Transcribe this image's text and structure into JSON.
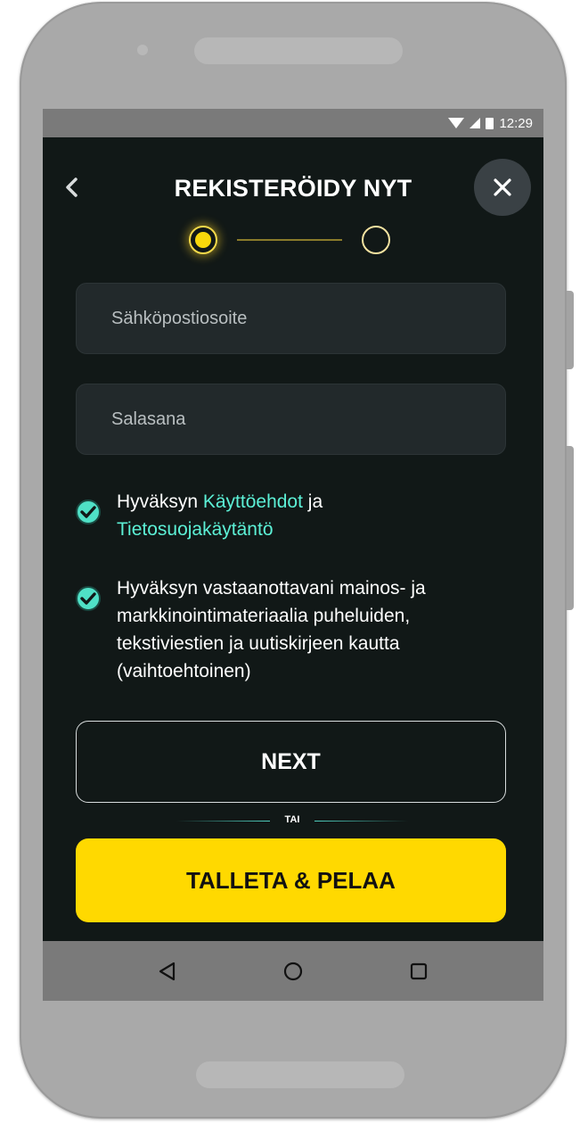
{
  "statusbar": {
    "time": "12:29"
  },
  "header": {
    "title": "REKISTERÖIDY NYT"
  },
  "stepper": {
    "current_step": 1,
    "total_steps": 2
  },
  "form": {
    "email_placeholder": "Sähköpostiosoite",
    "password_placeholder": "Salasana"
  },
  "consents": {
    "terms": {
      "checked": true,
      "prefix": "Hyväksyn ",
      "terms_link": "Käyttöehdot",
      "middle": " ja ",
      "privacy_link": "Tietosuojakäytäntö"
    },
    "marketing": {
      "checked": true,
      "text": "Hyväksyn vastaanottavani mainos- ja markkinointimateriaalia puheluiden, tekstiviestien ja uutiskirjeen kautta (vaihtoehtoinen)"
    }
  },
  "buttons": {
    "next_label": "NEXT",
    "divider_label": "TAI",
    "deposit_label": "TALLETA & PELAA"
  },
  "icons": {
    "back": "chevron-left-icon",
    "close": "close-icon",
    "check": "checkmark-icon",
    "nav_back": "triangle-back-icon",
    "nav_home": "circle-home-icon",
    "nav_recents": "square-recents-icon"
  },
  "colors": {
    "background": "#111817",
    "accent_yellow": "#ffd900",
    "link_teal": "#5cf0d6",
    "input_bg": "#22292b"
  }
}
